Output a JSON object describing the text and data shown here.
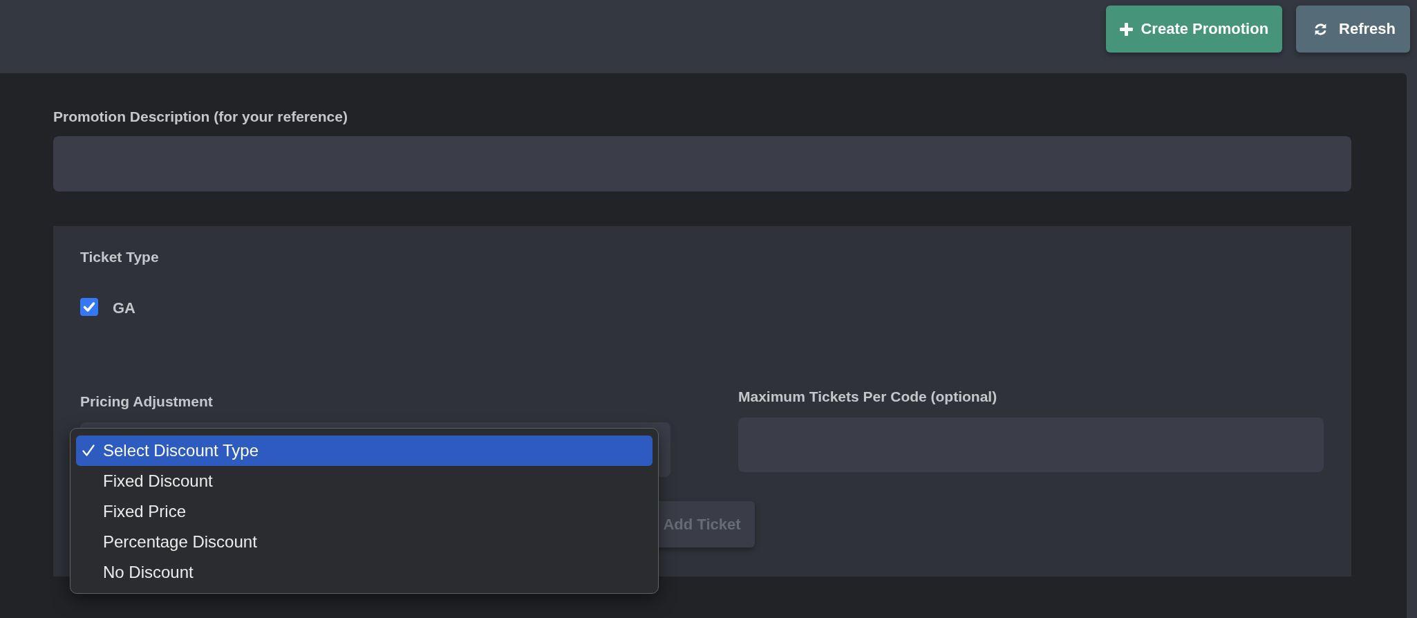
{
  "header": {
    "buttons": [
      {
        "kind": "create",
        "label": "Create Promotion"
      },
      {
        "kind": "refresh",
        "label": "Refresh"
      }
    ]
  },
  "description": {
    "label": "Promotion Description (for your reference)"
  },
  "ticket_section": {
    "ticket_type": {
      "label": "Ticket Type",
      "options": [
        {
          "label": "GA",
          "checked": true
        }
      ]
    },
    "pricing_adjustment": {
      "label": "Pricing Adjustment",
      "expanded": true,
      "options": [
        {
          "label": "Select Discount Type",
          "selected": true
        },
        {
          "label": "Fixed Discount",
          "selected": false
        },
        {
          "label": "Fixed Price",
          "selected": false
        },
        {
          "label": "Percentage Discount",
          "selected": false
        },
        {
          "label": "No Discount",
          "selected": false
        }
      ]
    },
    "max_tickets": {
      "label": "Maximum Tickets Per Code (optional)"
    },
    "add_ticket_button": {
      "label": "Add Ticket",
      "disabled": true
    }
  }
}
